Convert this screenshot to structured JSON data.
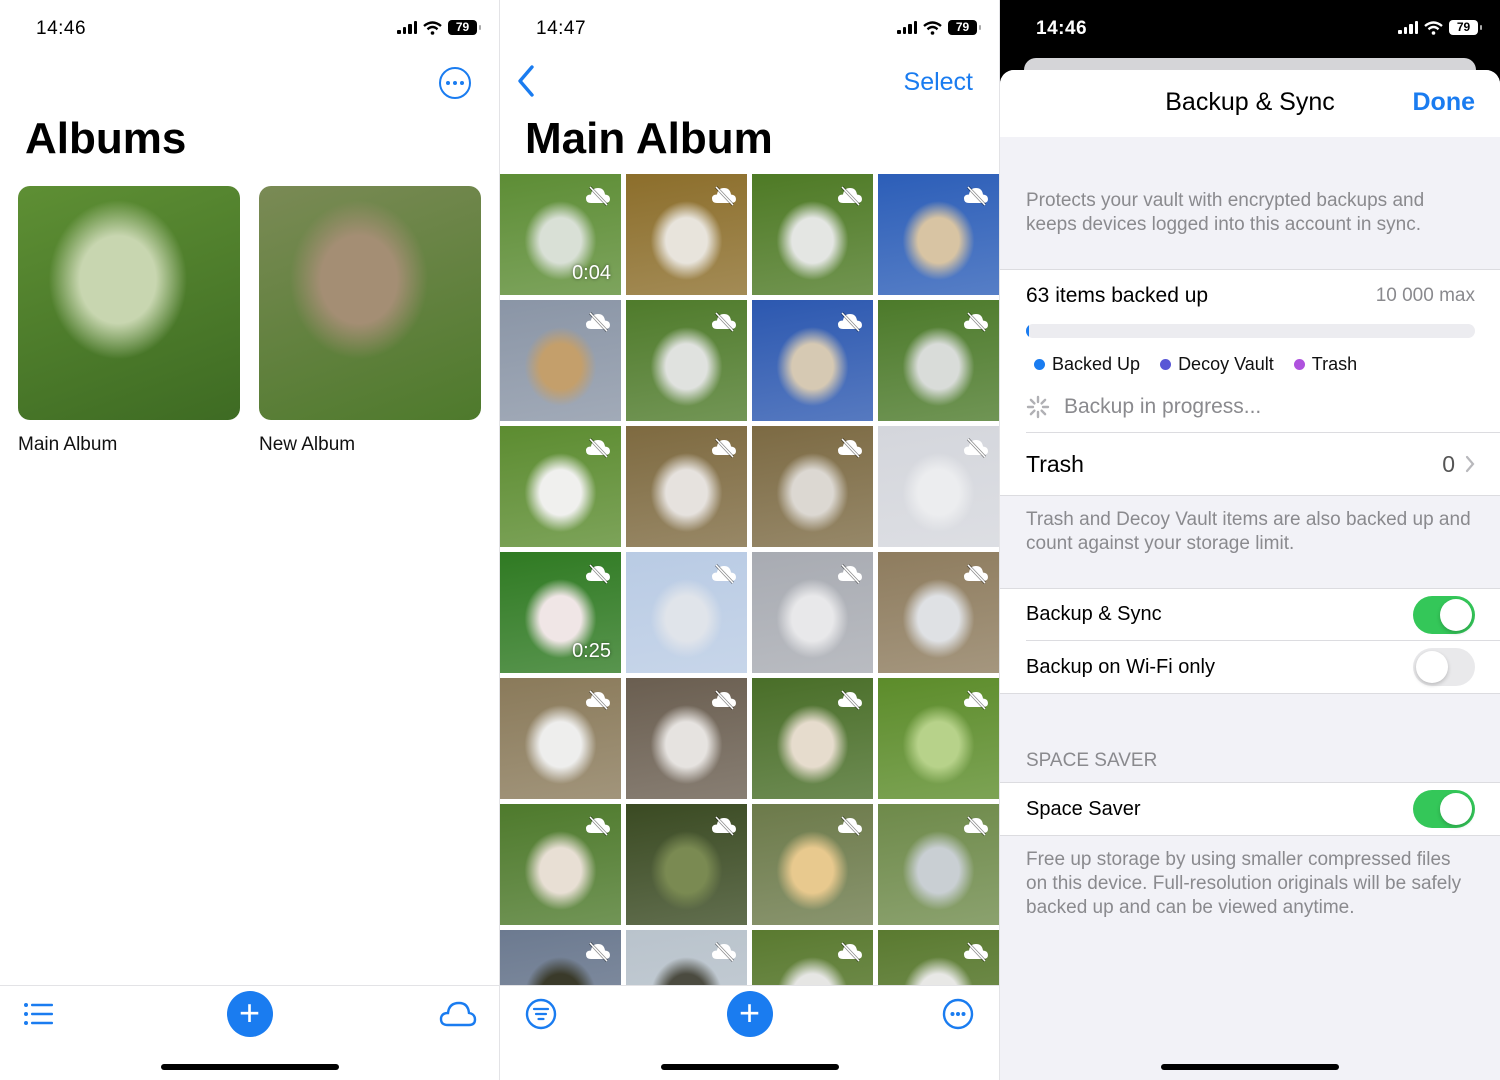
{
  "screens": [
    {
      "status": {
        "time": "14:46",
        "battery": "79"
      },
      "title": "Albums",
      "albums": [
        {
          "name": "Main Album",
          "colors": [
            "#5e8f34",
            "#c8d6b0",
            "#3e6b23"
          ]
        },
        {
          "name": "New Album",
          "colors": [
            "#7a8a55",
            "#a48e74",
            "#4e7a2c"
          ]
        }
      ],
      "tabbar": {
        "left_icon": "list-icon",
        "center_icon": "add-icon",
        "right_icon": "cloud-icon"
      }
    },
    {
      "status": {
        "time": "14:47",
        "battery": "79"
      },
      "nav": {
        "back_icon": "chevron-left-icon",
        "select_label": "Select"
      },
      "title": "Main Album",
      "photos": [
        {
          "colors": [
            "#5d8d35",
            "#d9e0d6"
          ],
          "duration": "0:04"
        },
        {
          "colors": [
            "#8c6e2b",
            "#e8e4dc"
          ],
          "duration": ""
        },
        {
          "colors": [
            "#4e7a25",
            "#e4e6e3"
          ],
          "duration": ""
        },
        {
          "colors": [
            "#2c5eb8",
            "#d8c4a3"
          ],
          "duration": ""
        },
        {
          "colors": [
            "#8a95a6",
            "#c49f6b"
          ],
          "duration": ""
        },
        {
          "colors": [
            "#4f7b2b",
            "#e0e2df"
          ],
          "duration": ""
        },
        {
          "colors": [
            "#2c58b0",
            "#d6c9b3"
          ],
          "duration": ""
        },
        {
          "colors": [
            "#4c7a2a",
            "#d9dcd9"
          ],
          "duration": ""
        },
        {
          "colors": [
            "#5c8c30",
            "#f0f0ee"
          ],
          "duration": ""
        },
        {
          "colors": [
            "#7e6a40",
            "#e6e2de"
          ],
          "duration": ""
        },
        {
          "colors": [
            "#7c6a43",
            "#dcd8d2"
          ],
          "duration": ""
        },
        {
          "colors": [
            "#d4d6dc",
            "#ecedef"
          ],
          "duration": ""
        },
        {
          "colors": [
            "#2f7a22",
            "#f0e6e6"
          ],
          "duration": "0:25"
        },
        {
          "colors": [
            "#b9cbe4",
            "#e0e4ea"
          ],
          "duration": ""
        },
        {
          "colors": [
            "#a8abb2",
            "#e8e8ea"
          ],
          "duration": ""
        },
        {
          "colors": [
            "#8e7c5e",
            "#dfe1e4"
          ],
          "duration": ""
        },
        {
          "colors": [
            "#8a7a5a",
            "#eeeeed"
          ],
          "duration": ""
        },
        {
          "colors": [
            "#6a5e50",
            "#e6e3e0"
          ],
          "duration": ""
        },
        {
          "colors": [
            "#496e28",
            "#e6dccd"
          ],
          "duration": ""
        },
        {
          "colors": [
            "#5c8c2a",
            "#b7d28a"
          ],
          "duration": ""
        },
        {
          "colors": [
            "#4e7a2c",
            "#e8dfd4"
          ],
          "duration": ""
        },
        {
          "colors": [
            "#3a4a22",
            "#7a8a52"
          ],
          "duration": ""
        },
        {
          "colors": [
            "#6c7a4a",
            "#e8c98e"
          ],
          "duration": ""
        },
        {
          "colors": [
            "#6e8a4a",
            "#c9cfd3"
          ],
          "duration": ""
        },
        {
          "colors": [
            "#6c7a90",
            "#3a3a2a"
          ],
          "duration": ""
        },
        {
          "colors": [
            "#b9c3cc",
            "#4b4b40"
          ],
          "duration": ""
        },
        {
          "colors": [
            "#5a7a30",
            "#e6e6e4"
          ],
          "duration": ""
        },
        {
          "colors": [
            "#5a7a30",
            "#e8e8e6"
          ],
          "duration": ""
        }
      ],
      "tabbar": {
        "left_icon": "filter-icon",
        "center_icon": "add-icon",
        "right_icon": "more-icon"
      }
    },
    {
      "status": {
        "time": "14:46",
        "battery": "79"
      },
      "sheet": {
        "title": "Backup & Sync",
        "done_label": "Done",
        "intro": "Protects your vault with encrypted backups and keeps  devices logged into this account in sync.",
        "items_backed_up": "63 items backed up",
        "max_label": "10 000 max",
        "progress_fraction": 0.0063,
        "legend": [
          {
            "label": "Backed Up",
            "color": "#1a7cf0"
          },
          {
            "label": "Decoy Vault",
            "color": "#5856d6"
          },
          {
            "label": "Trash",
            "color": "#af52de"
          }
        ],
        "progress_status": "Backup in progress...",
        "trash_label": "Trash",
        "trash_count": "0",
        "trash_note": "Trash and Decoy Vault items are also backed up and count against your storage limit.",
        "toggles": [
          {
            "label": "Backup & Sync",
            "on": true
          },
          {
            "label": "Backup on Wi-Fi only",
            "on": false
          }
        ],
        "space_saver_header": "SPACE SAVER",
        "space_saver": {
          "label": "Space Saver",
          "on": true
        },
        "space_saver_note": "Free up storage by using smaller compressed files on this device. Full-resolution originals will be safely backed up and can be viewed anytime."
      }
    }
  ]
}
